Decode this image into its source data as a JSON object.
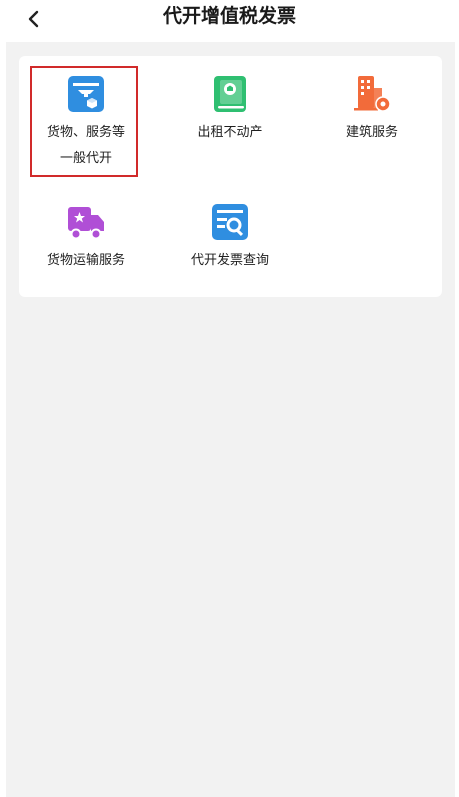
{
  "header": {
    "title": "代开增值税发票"
  },
  "services": [
    {
      "label_line1": "货物、服务等",
      "label_line2": "一般代开",
      "icon": "goods-service-invoice-icon"
    },
    {
      "label": "出租不动产",
      "icon": "property-rental-book-icon"
    },
    {
      "label": "建筑服务",
      "icon": "building-service-icon"
    },
    {
      "label": "货物运输服务",
      "icon": "freight-truck-icon"
    },
    {
      "label": "代开发票查询",
      "icon": "invoice-query-icon"
    }
  ],
  "colors": {
    "blue": "#2f8ee0",
    "green": "#2fbf71",
    "orange": "#f26b3a",
    "purple": "#b04fd6",
    "highlight": "#d12a2a",
    "background": "#f2f2f2"
  }
}
